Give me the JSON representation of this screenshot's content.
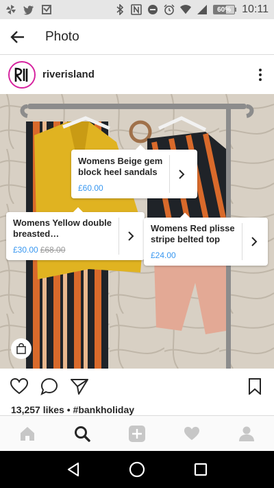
{
  "status_bar": {
    "notification_icons": [
      "pinwheel-icon",
      "twitter-icon",
      "inbox-icon"
    ],
    "system_icons": [
      "bluetooth-icon",
      "nfc-icon",
      "do-not-disturb-icon",
      "alarm-icon",
      "wifi-icon",
      "signal-icon"
    ],
    "battery_percent": "60%",
    "battery_level": 0.6,
    "time": "10:11"
  },
  "app_bar": {
    "title": "Photo"
  },
  "post": {
    "username": "riverisland",
    "avatar_text": "RI",
    "likes": "13,257 likes",
    "caption_tag": "#bankholiday",
    "separator": " • "
  },
  "tags": [
    {
      "name_line1": "Womens Beige gem",
      "name_line2": "block heel sandals",
      "price": "£60.00",
      "old_price": ""
    },
    {
      "name_line1": "Womens Yellow double",
      "name_line2": "breasted…",
      "price": "£30.00",
      "old_price": "£68.00"
    },
    {
      "name_line1": "Womens Red plisse",
      "name_line2": "stripe belted top",
      "price": "£24.00",
      "old_price": ""
    }
  ],
  "colors": {
    "accent_blue": "#3897f0",
    "text": "#262626",
    "muted": "#999999",
    "avatar_ring": "#d6249f"
  }
}
